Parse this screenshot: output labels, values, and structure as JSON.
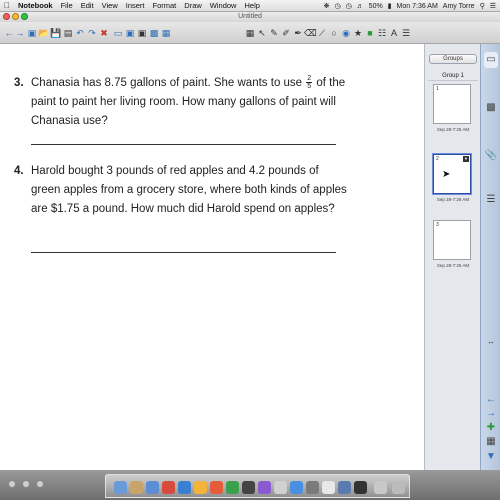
{
  "menubar": {
    "app_name": "Notebook",
    "menus": [
      "File",
      "Edit",
      "View",
      "Insert",
      "Format",
      "Draw",
      "Window",
      "Help"
    ],
    "battery": "50%",
    "clock": "Mon 7:36 AM",
    "user": "Amy Torre"
  },
  "window": {
    "title": "Untitled"
  },
  "problems": [
    {
      "number": "3.",
      "text_before": "Chanasia has 8.75 gallons of paint. She wants to use ",
      "fraction_numerator": "2",
      "fraction_denominator": "5",
      "text_after": " of the paint to paint her living room. How many gallons of paint will Chanasia use?"
    },
    {
      "number": "4.",
      "text": "Harold bought 3 pounds of red apples and 4.2 pounds of green apples from a grocery store, where both kinds of apples are $1.75 a pound. How much did Harold spend on apples?"
    }
  ],
  "sorter": {
    "groups_label": "Groups",
    "group_name": "Group 1",
    "pages": [
      {
        "number": "1",
        "date": "Sep 28-7:25 AM"
      },
      {
        "number": "2",
        "date": "Sep 28-7:26 AM"
      },
      {
        "number": "3",
        "date": "Sep 28-7:26 AM"
      }
    ],
    "selected_page": 2
  },
  "colors": {
    "accent": "#2e6fb7",
    "sorter_bg": "#e4e7ec",
    "selection": "#2d4ea0"
  }
}
